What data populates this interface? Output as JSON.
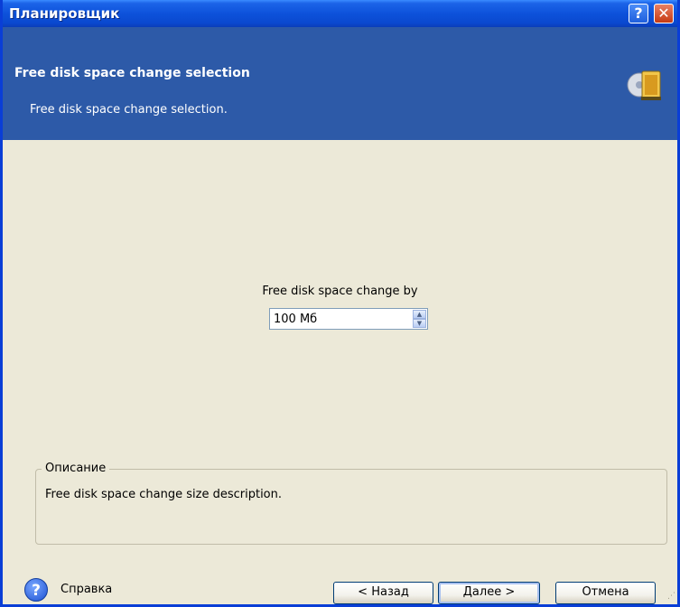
{
  "window": {
    "title": "Планировщик",
    "help_glyph": "?",
    "close_glyph": "✕"
  },
  "header": {
    "title": "Free disk space change selection",
    "subtitle": "Free disk space change selection.",
    "icon": "wizard-disc-folder-icon",
    "background": "#2d5aa8"
  },
  "form": {
    "label": "Free disk space change by",
    "value": "100 Мб"
  },
  "description": {
    "legend": "Описание",
    "text": "Free disk space change size description."
  },
  "footer": {
    "help_label": "Справка",
    "back_label": "< Назад",
    "next_label": "Далее >",
    "cancel_label": "Отмена"
  }
}
